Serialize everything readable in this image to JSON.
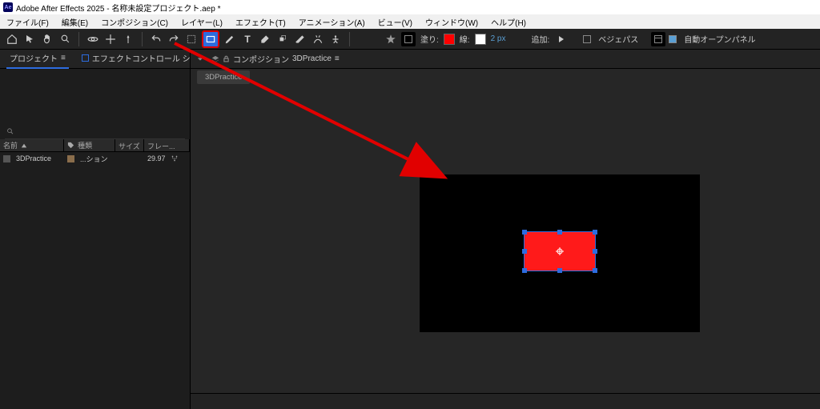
{
  "title": "Adobe After Effects 2025 - 名称未設定プロジェクト.aep *",
  "appIcon": "Ae",
  "menu": {
    "file": "ファイル(F)",
    "edit": "編集(E)",
    "composition": "コンポジション(C)",
    "layer": "レイヤー(L)",
    "effect": "エフェクト(T)",
    "animation": "アニメーション(A)",
    "view": "ビュー(V)",
    "window": "ウィンドウ(W)",
    "help": "ヘルプ(H)"
  },
  "toolbar": {
    "fillLabel": "塗り:",
    "strokeLabel": "線:",
    "strokeValue": "2 px",
    "addLabel": "追加:",
    "bezierLabel": "ベジェパス",
    "autoOpenLabel": "自動オープンパネル",
    "fillColor": "#ff0000",
    "strokeColor": "#ffffff"
  },
  "panels": {
    "projectTab": "プロジェクト",
    "effectControlsTab": "エフェクトコントロール シェイプレイヤ",
    "menuIcon": "≡",
    "searchPlaceholder": ""
  },
  "projectColumns": {
    "name": "名前",
    "type": "種類",
    "size": "サイズ",
    "rate": "フレー..."
  },
  "projectRow": {
    "name": "3DPractice",
    "type": "...ション",
    "size": "",
    "rate": "29.97"
  },
  "viewer": {
    "compTabPrefix": "コンポジション",
    "compTabName": "3DPractice",
    "menuIcon": "≡",
    "renderTab": "3DPractice"
  }
}
